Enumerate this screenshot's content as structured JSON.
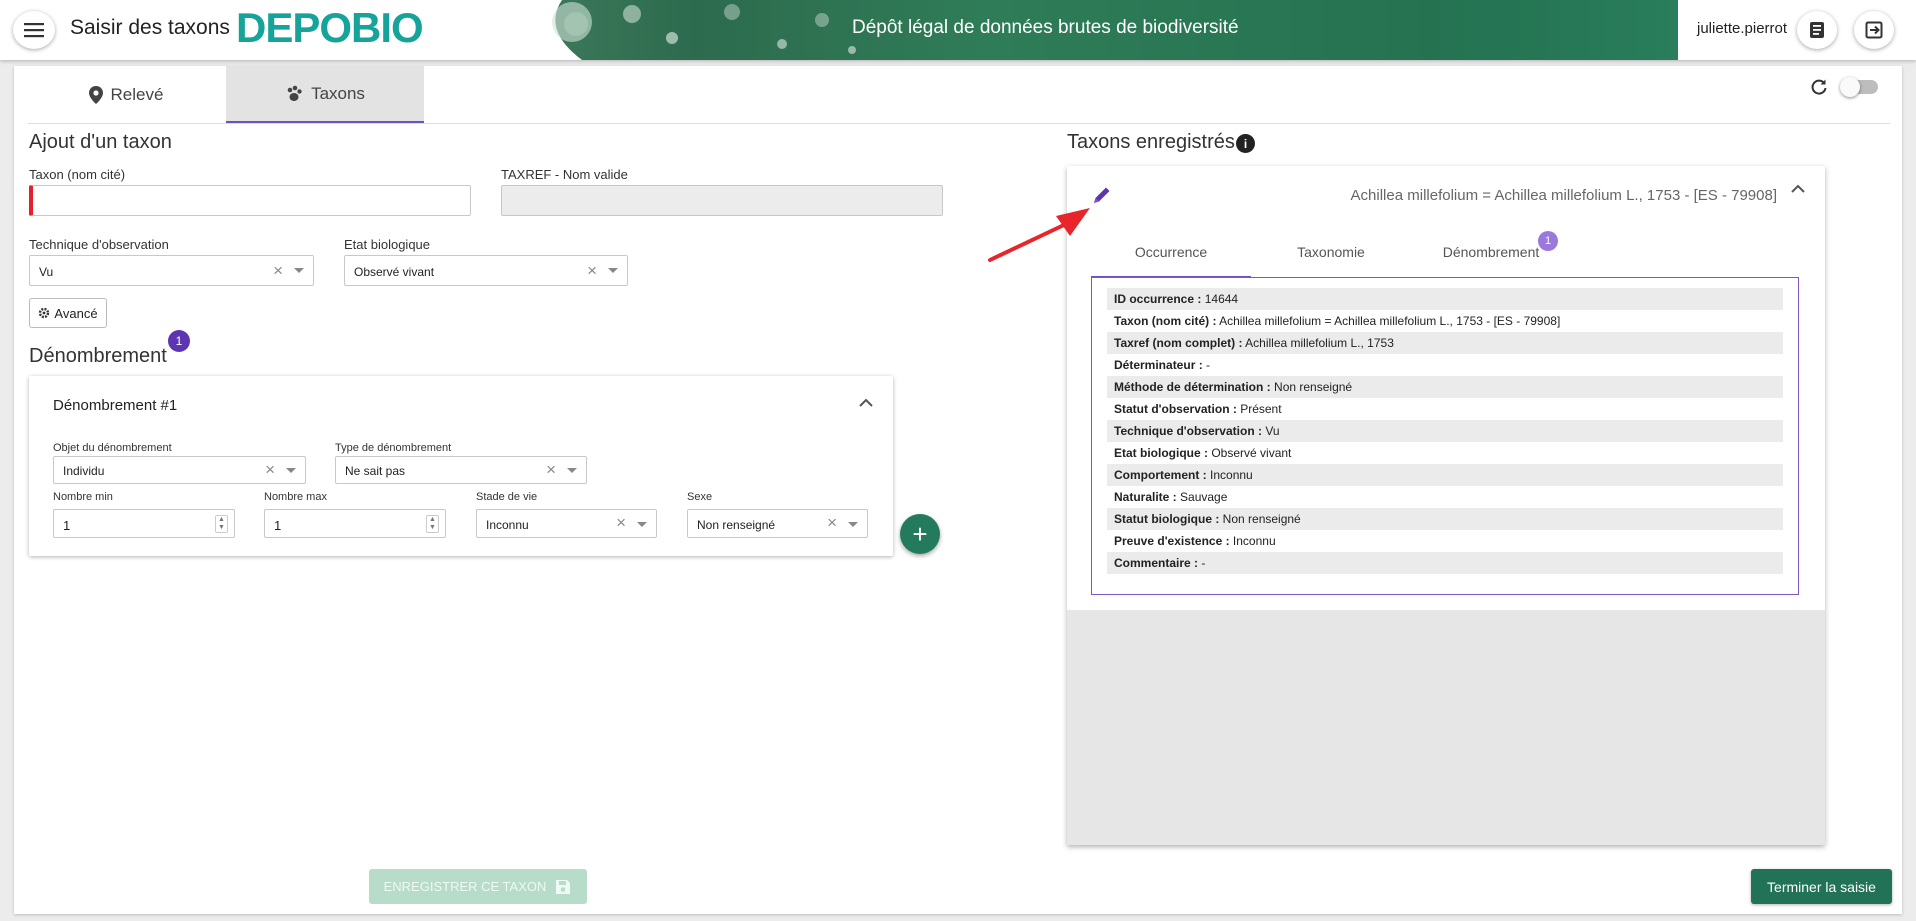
{
  "header": {
    "app_title": "Saisir des taxons",
    "brand": "DEPOBIO",
    "banner_text": "Dépôt légal de données brutes de biodiversité",
    "user": "juliette.pierrot",
    "icons": {
      "menu": "menu-icon",
      "doc": "book-icon",
      "logout": "logout-icon"
    }
  },
  "tabs": [
    {
      "label": "Relevé",
      "icon": "map-marker-icon"
    },
    {
      "label": "Taxons",
      "icon": "paw-icon"
    }
  ],
  "left": {
    "title": "Ajout d'un taxon",
    "taxon_label": "Taxon (nom cité)",
    "taxon_value": "",
    "taxref_label": "TAXREF - Nom valide",
    "taxref_value": "",
    "technique_label": "Technique d'observation",
    "technique_value": "Vu",
    "etat_label": "Etat biologique",
    "etat_value": "Observé vivant",
    "advanced_label": "Avancé",
    "denom_title": "Dénombrement",
    "denom_badge": "1",
    "denom_card": {
      "title": "Dénombrement #1",
      "objet_label": "Objet du dénombrement",
      "objet_value": "Individu",
      "type_label": "Type de dénombrement",
      "type_value": "Ne sait pas",
      "min_label": "Nombre min",
      "min_value": "1",
      "max_label": "Nombre max",
      "max_value": "1",
      "stade_label": "Stade de vie",
      "stade_value": "Inconnu",
      "sexe_label": "Sexe",
      "sexe_value": "Non renseigné"
    }
  },
  "right": {
    "title": "Taxons enregistrés",
    "taxon_header": "Achillea millefolium = Achillea millefolium L., 1753 - [ES - 79908]",
    "subtabs": [
      "Occurrence",
      "Taxonomie",
      "Dénombrement"
    ],
    "subtab_badge": "1",
    "details": [
      {
        "label": "ID occurrence :",
        "value": "14644"
      },
      {
        "label": "Taxon (nom cité) :",
        "value": "Achillea millefolium = Achillea millefolium L., 1753 - [ES - 79908]"
      },
      {
        "label": "Taxref (nom complet) :",
        "value": "Achillea millefolium L., 1753"
      },
      {
        "label": "Déterminateur :",
        "value": "-"
      },
      {
        "label": "Méthode de détermination :",
        "value": "Non renseigné"
      },
      {
        "label": "Statut d'observation :",
        "value": "Présent"
      },
      {
        "label": "Technique d'observation :",
        "value": "Vu"
      },
      {
        "label": "Etat biologique :",
        "value": "Observé vivant"
      },
      {
        "label": "Comportement :",
        "value": "Inconnu"
      },
      {
        "label": "Naturalite :",
        "value": "Sauvage"
      },
      {
        "label": "Statut biologique :",
        "value": "Non renseigné"
      },
      {
        "label": "Preuve d'existence :",
        "value": "Inconnu"
      },
      {
        "label": "Commentaire :",
        "value": "-"
      }
    ]
  },
  "footer": {
    "save_label": "ENREGISTRER CE TAXON",
    "finish_label": "Terminer la saisie"
  },
  "colors": {
    "brand": "#16a49a",
    "accent": "#6e4fc4",
    "primary_green": "#217256",
    "annotation": "#e8252a"
  }
}
